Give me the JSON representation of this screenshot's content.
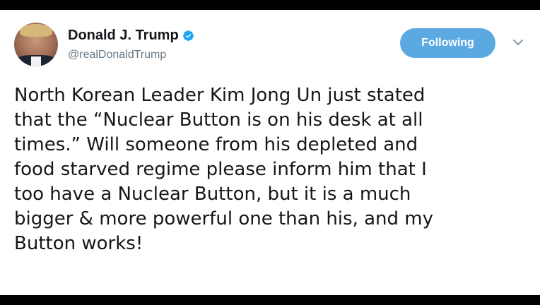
{
  "tweet": {
    "author": {
      "display_name": "Donald J. Trump",
      "handle": "@realDonaldTrump",
      "verified_icon": "verified-badge-icon",
      "avatar_icon": "profile-photo"
    },
    "follow_button_label": "Following",
    "menu_icon": "chevron-down-icon",
    "text_lines": [
      "North Korean Leader Kim Jong Un just stated",
      "that the “Nuclear Button is on his desk at all",
      "times.” Will someone from his depleted and",
      "food starved regime please inform him that I",
      "too have a Nuclear Button, but it is a much",
      "bigger & more powerful one than his, and my",
      "Button works!"
    ]
  },
  "colors": {
    "background": "#ffffff",
    "letterbox": "#000000",
    "button_bg": "#5ba9e1",
    "handle_text": "#657786",
    "verified_blue": "#1da1f2"
  }
}
